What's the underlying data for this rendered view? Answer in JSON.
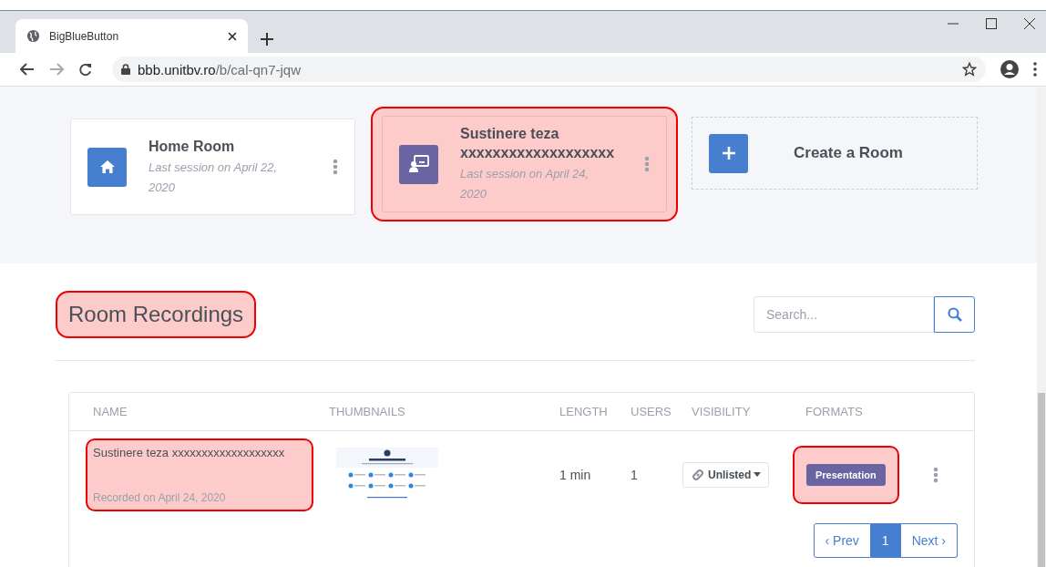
{
  "browser": {
    "tab_title": "BigBlueButton",
    "url_host": "bbb.unitbv.ro",
    "url_path": "/b/cal-qn7-jqw"
  },
  "rooms": [
    {
      "kind": "home",
      "name": "Home Room",
      "subtitle": "Last session on April 22, 2020",
      "color": "#467fcf",
      "highlighted": false
    },
    {
      "kind": "presentation",
      "name": "Sustinere teza xxxxxxxxxxxxxxxxxxx",
      "subtitle": "Last session on April 24, 2020",
      "color": "#6b64a3",
      "highlighted": true
    }
  ],
  "create_room": {
    "label": "Create a Room"
  },
  "recordings": {
    "title": "Room Recordings",
    "title_highlighted": true,
    "search": {
      "placeholder": "Search..."
    },
    "columns": [
      "NAME",
      "THUMBNAILS",
      "LENGTH",
      "USERS",
      "VISIBILITY",
      "FORMATS"
    ],
    "rows": [
      {
        "name": "Sustinere teza xxxxxxxxxxxxxxxxxxx",
        "recorded": "Recorded on April 24, 2020",
        "name_highlighted": true,
        "length": "1 min",
        "users": "1",
        "visibility": "Unlisted",
        "formats": [
          "Presentation"
        ],
        "formats_highlighted": true
      }
    ],
    "pagination": {
      "prev": "‹ Prev",
      "pages": [
        {
          "label": "1",
          "selected": true
        }
      ],
      "next": "Next ›"
    }
  }
}
